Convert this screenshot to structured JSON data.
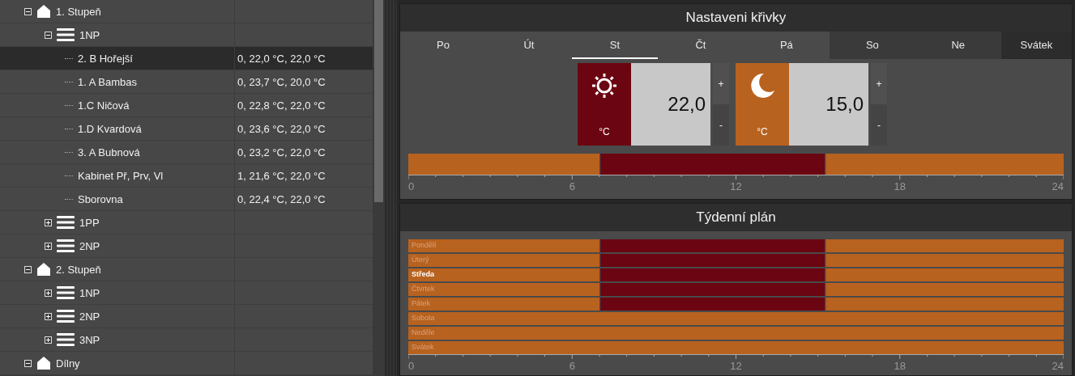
{
  "tree": [
    {
      "label": "1. Stupeň",
      "kind": "building",
      "expanded": true,
      "children": [
        {
          "label": "1NP",
          "kind": "floor",
          "expanded": true,
          "children": [
            {
              "label": "2. B Hořejší",
              "kind": "room",
              "value": "0, 22,0 °C, 22,0 °C",
              "selected": true
            },
            {
              "label": "1. A Bambas",
              "kind": "room",
              "value": "0, 23,7 °C, 20,0 °C",
              "selected": false
            },
            {
              "label": "1.C Ničová",
              "kind": "room",
              "value": "0, 22,8 °C, 22,0 °C",
              "selected": false
            },
            {
              "label": "1.D Kvardová",
              "kind": "room",
              "value": "0, 23,6 °C, 22,0 °C",
              "selected": false
            },
            {
              "label": "3. A Bubnová",
              "kind": "room",
              "value": "0, 23,2 °C, 22,0 °C",
              "selected": false
            },
            {
              "label": "Kabinet Př, Prv, Vl",
              "kind": "room",
              "value": "1, 21,6 °C, 22,0 °C",
              "selected": false
            },
            {
              "label": "Sborovna",
              "kind": "room",
              "value": "0, 22,4 °C, 22,0 °C",
              "selected": false
            }
          ]
        },
        {
          "label": "1PP",
          "kind": "floor",
          "expanded": false
        },
        {
          "label": "2NP",
          "kind": "floor",
          "expanded": false
        }
      ]
    },
    {
      "label": "2. Stupeň",
      "kind": "building",
      "expanded": true,
      "children": [
        {
          "label": "1NP",
          "kind": "floor",
          "expanded": false
        },
        {
          "label": "2NP",
          "kind": "floor",
          "expanded": false
        },
        {
          "label": "3NP",
          "kind": "floor",
          "expanded": false
        }
      ]
    },
    {
      "label": "Dílny",
      "kind": "building",
      "expanded": true
    }
  ],
  "curve": {
    "title": "Nastaveni křivky",
    "tabs": [
      {
        "label": "Po",
        "kind": "workday",
        "selected": false
      },
      {
        "label": "Út",
        "kind": "workday",
        "selected": false
      },
      {
        "label": "St",
        "kind": "workday",
        "selected": true
      },
      {
        "label": "Čt",
        "kind": "workday",
        "selected": false
      },
      {
        "label": "Pá",
        "kind": "workday",
        "selected": false
      },
      {
        "label": "So",
        "kind": "weekend",
        "selected": false
      },
      {
        "label": "Ne",
        "kind": "weekend",
        "selected": false
      },
      {
        "label": "Svátek",
        "kind": "holiday",
        "selected": false
      }
    ],
    "modes": [
      {
        "kind": "day",
        "color": "#6b0511",
        "unit": "°C",
        "value": "22,0",
        "plus": "+",
        "minus": "-"
      },
      {
        "kind": "night",
        "color": "#b8621f",
        "unit": "°C",
        "value": "15,0",
        "plus": "+",
        "minus": "-"
      }
    ],
    "chart_data": {
      "type": "bar",
      "orientation": "horizontal",
      "stacked": true,
      "xlim": [
        0,
        24
      ],
      "xticks": [
        0,
        6,
        12,
        18,
        24
      ],
      "series": [
        {
          "color": "#b8621f",
          "values": [
            7
          ]
        },
        {
          "color": "#6b0511",
          "values": [
            8.25
          ]
        },
        {
          "color": "#b8621f",
          "values": [
            8.75
          ]
        }
      ]
    }
  },
  "weekly": {
    "title": "Týdenní plán",
    "days": [
      {
        "selected": false
      },
      {
        "selected": false
      },
      {
        "selected": true
      },
      {
        "selected": false
      },
      {
        "selected": false
      },
      {
        "selected": false
      },
      {
        "selected": false
      },
      {
        "selected": false
      }
    ],
    "chart_data": {
      "type": "bar",
      "orientation": "horizontal",
      "stacked": true,
      "xlim": [
        0,
        24
      ],
      "xticks": [
        0,
        6,
        12,
        18,
        24
      ],
      "categories": [
        "Pondělí",
        "Úterý",
        "Středa",
        "Čtvrtek",
        "Pátek",
        "Sobota",
        "Neděle",
        "Svátek"
      ],
      "series": [
        {
          "color": "#b8621f",
          "values": [
            7,
            7,
            7,
            7,
            7,
            24,
            24,
            24
          ]
        },
        {
          "color": "#6b0511",
          "values": [
            8.25,
            8.25,
            8.25,
            8.25,
            8.25,
            null,
            null,
            null
          ]
        },
        {
          "color": "#b8621f",
          "values": [
            8.75,
            8.75,
            8.75,
            8.75,
            8.75,
            null,
            null,
            null
          ]
        }
      ]
    }
  }
}
